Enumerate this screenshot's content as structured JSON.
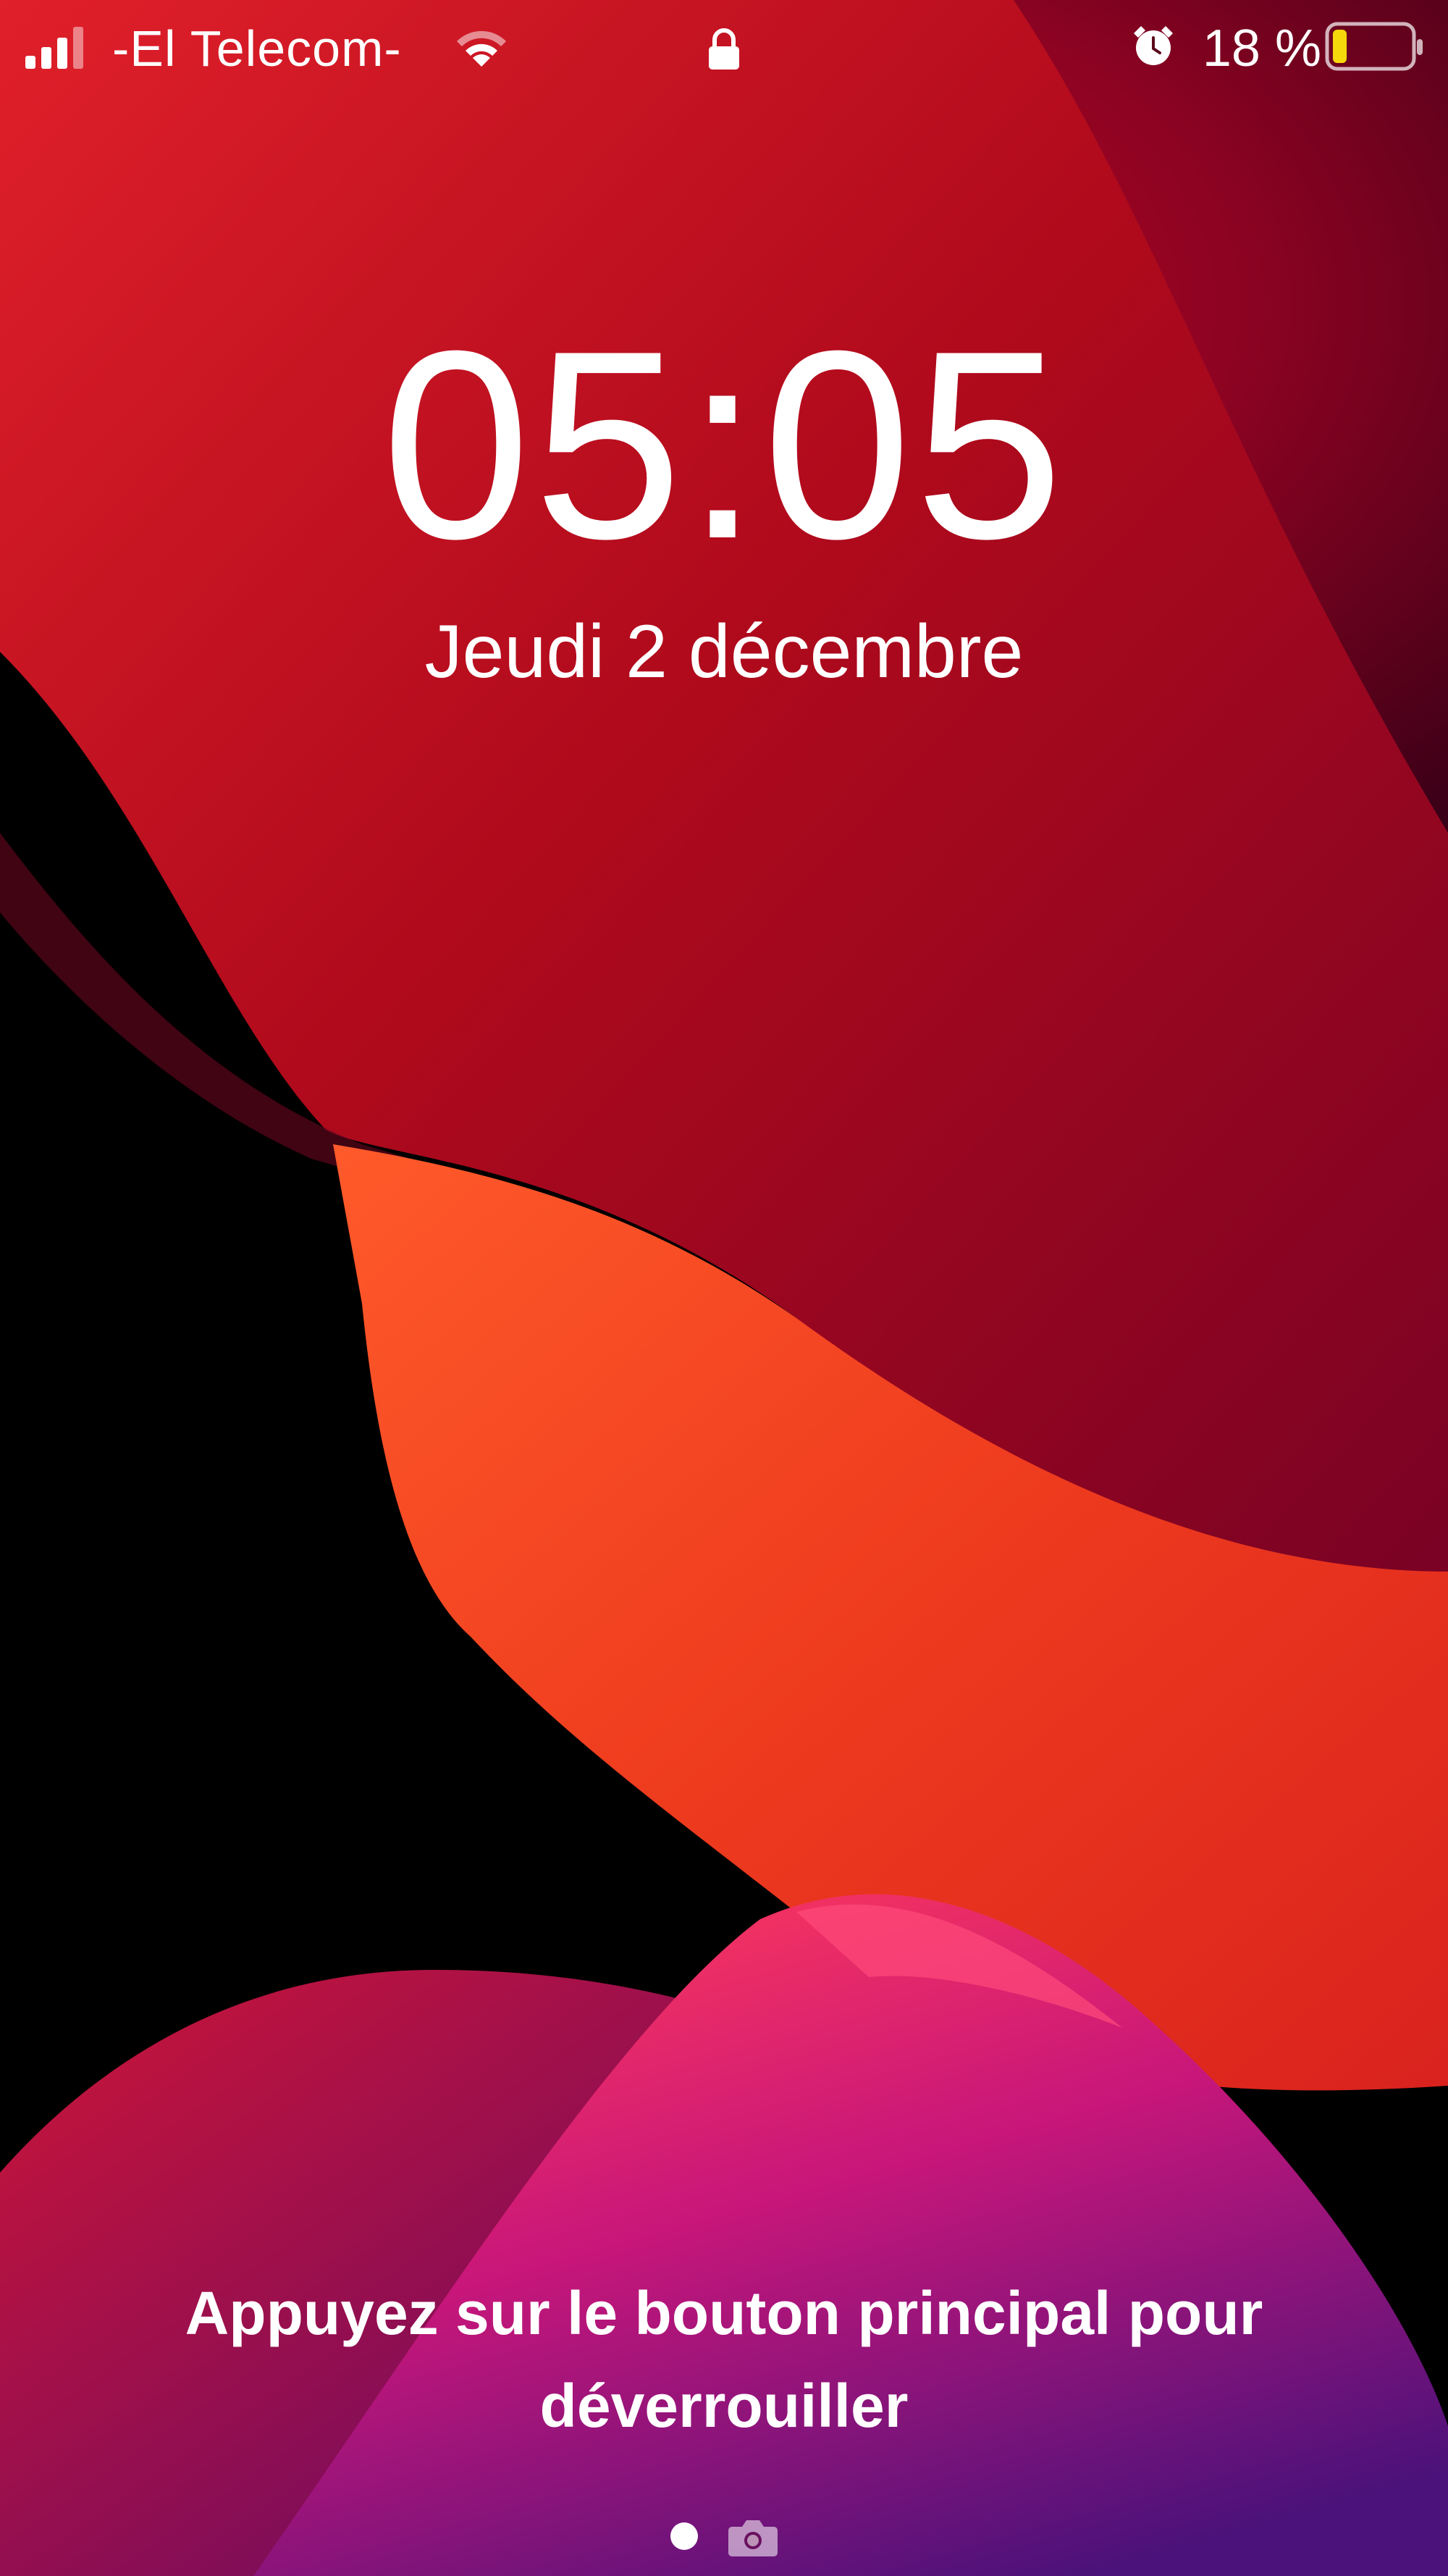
{
  "status_bar": {
    "carrier": "-El Telecom-",
    "battery_percent": "18 %",
    "battery_level": 0.18,
    "battery_color": "#f5d90a",
    "icons": [
      "cellular-signal-icon",
      "wifi-icon",
      "lock-icon",
      "alarm-icon",
      "battery-icon"
    ]
  },
  "lock_screen": {
    "time": "05:05",
    "date": "Jeudi 2 décembre",
    "unlock_hint": "Appuyez sur le bouton principal pour déverrouiller"
  },
  "page_indicator": {
    "icons": [
      "page-dot-icon",
      "camera-icon"
    ]
  },
  "colors": {
    "background": "#000000",
    "wallpaper_red": "#b5001c",
    "wallpaper_orange": "#f0401e",
    "wallpaper_magenta": "#c0146e"
  }
}
